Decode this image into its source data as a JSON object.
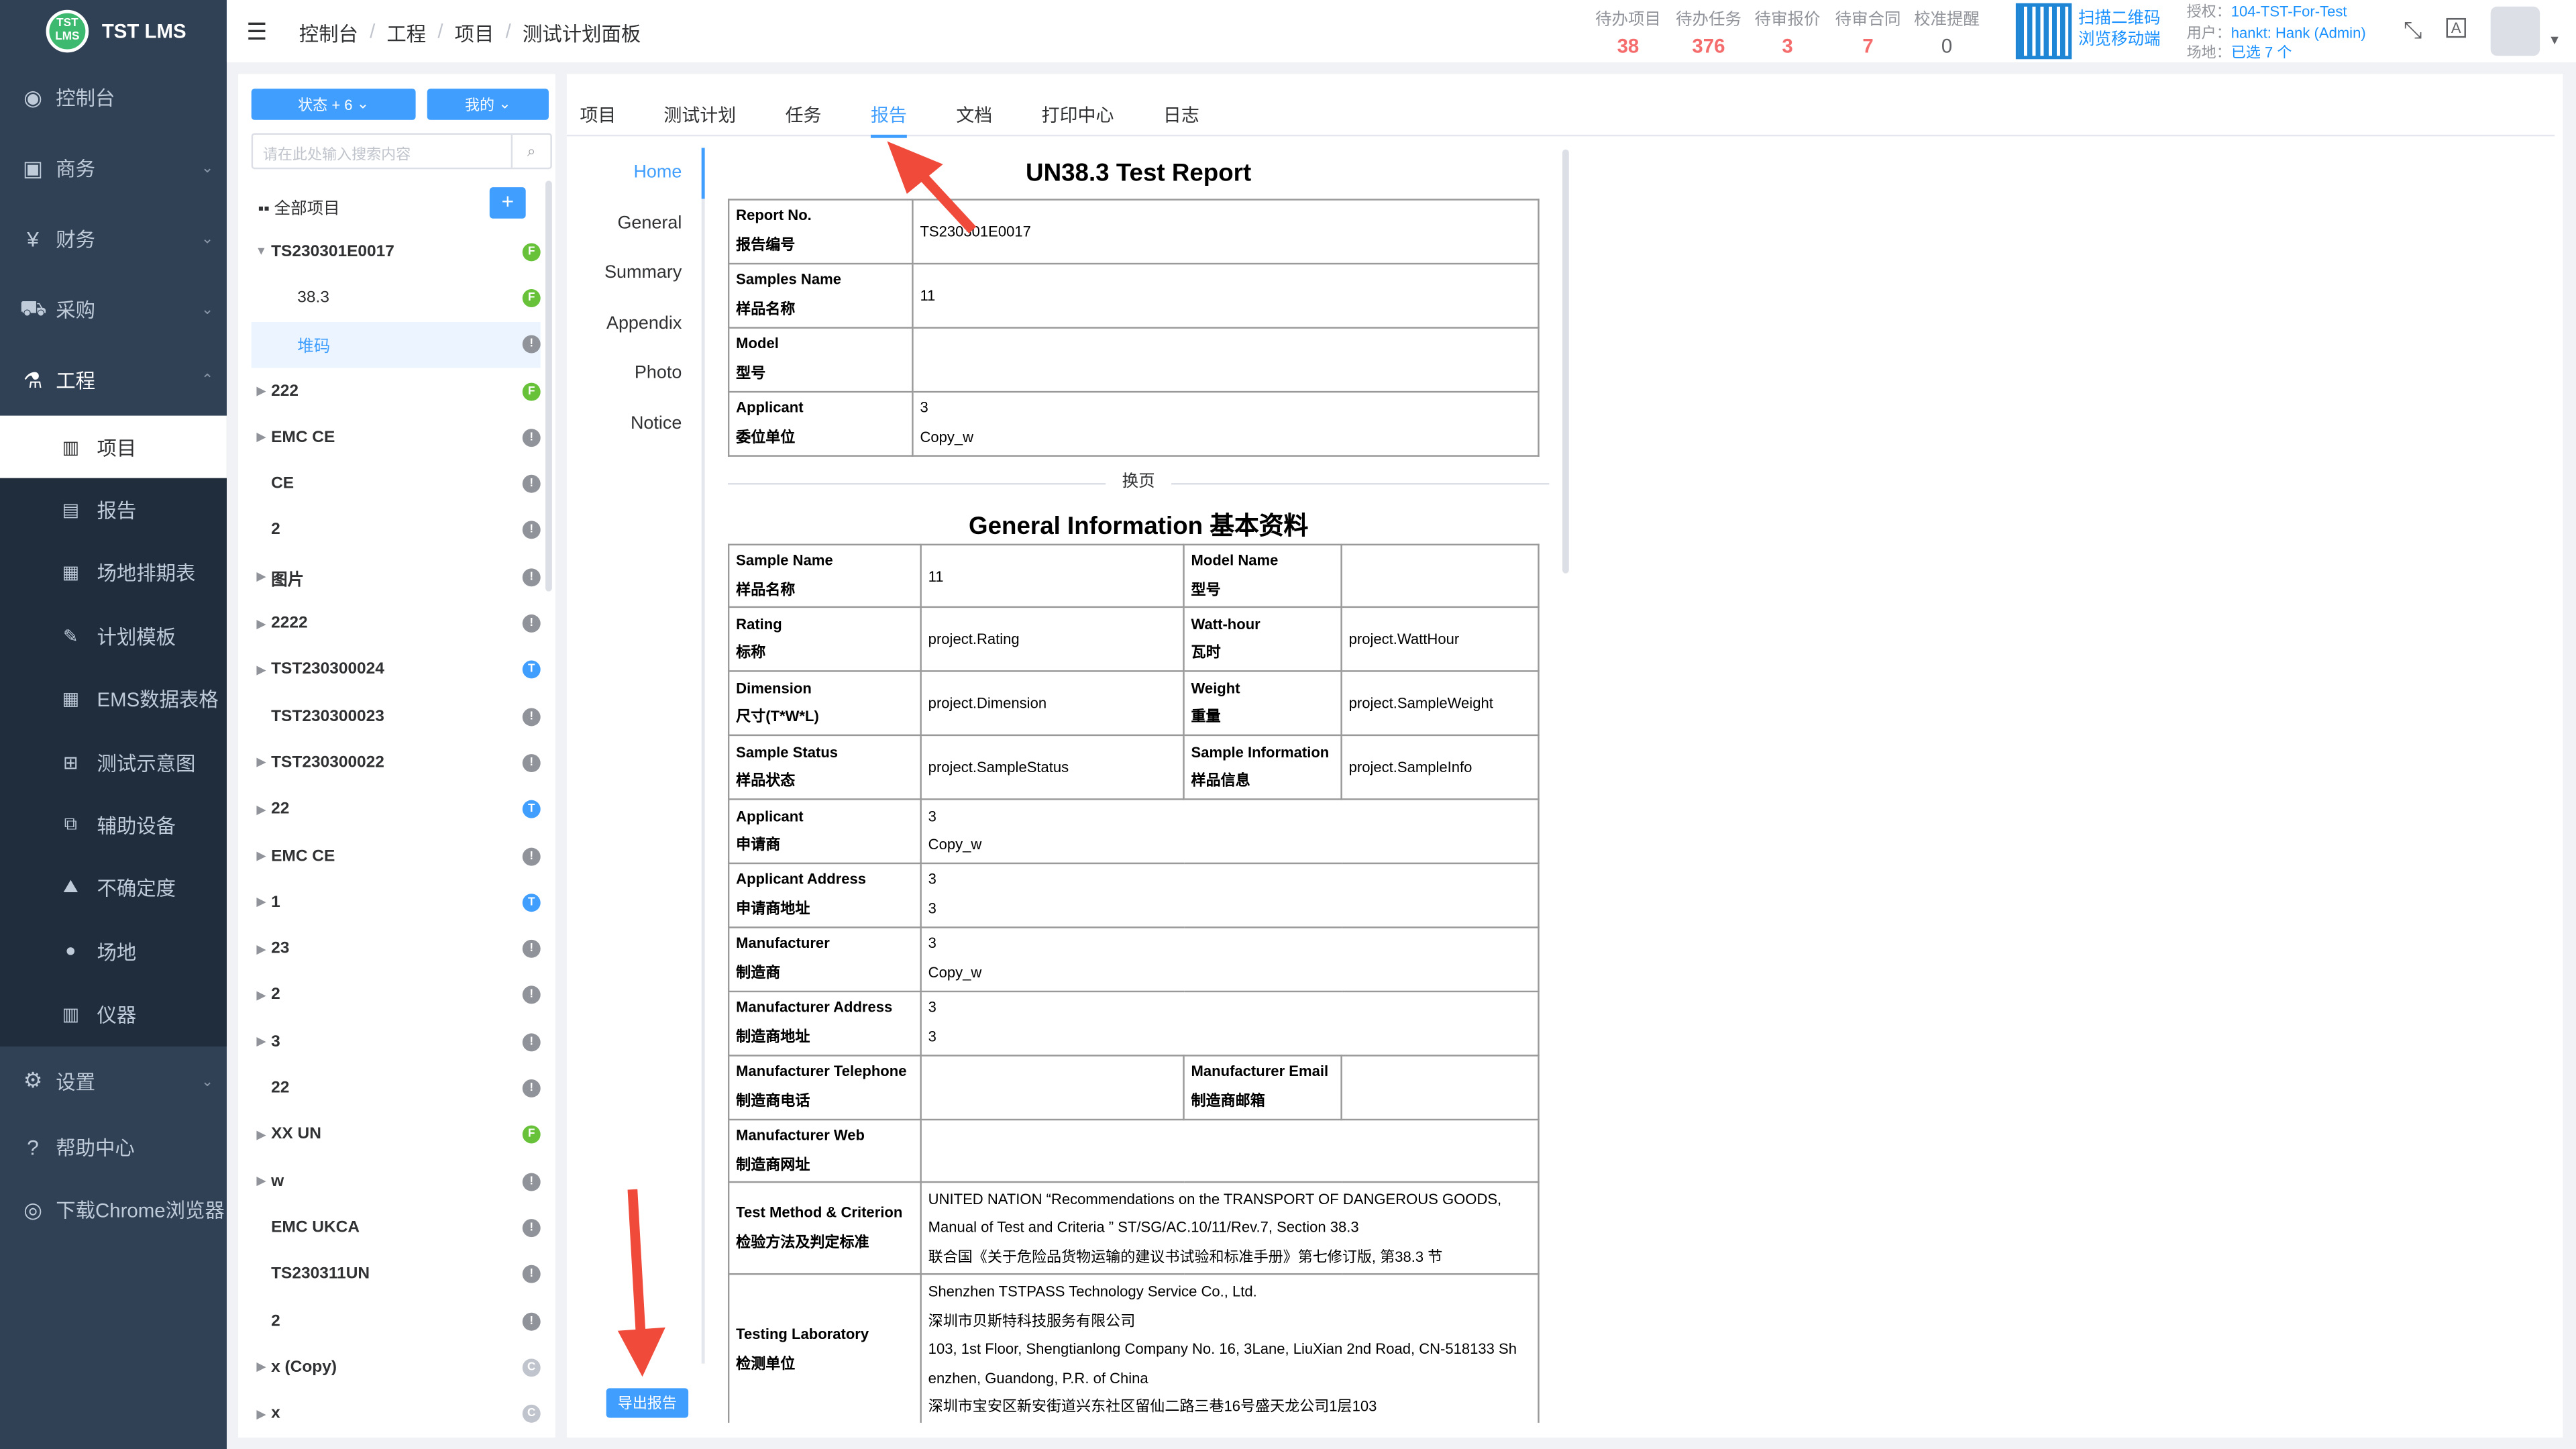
{
  "app": {
    "logo_line1": "TST",
    "logo_line2": "LMS",
    "name": "TST LMS"
  },
  "sidebar": {
    "items": [
      {
        "label": "控制台",
        "icon": "dashboard-icon"
      },
      {
        "label": "商务",
        "icon": "shopping-bag-icon"
      },
      {
        "label": "财务",
        "icon": "yen-icon"
      },
      {
        "label": "采购",
        "icon": "cart-icon"
      },
      {
        "label": "工程",
        "icon": "flask-icon"
      }
    ],
    "sub_items": [
      {
        "label": "项目",
        "icon": "project-icon"
      },
      {
        "label": "报告",
        "icon": "report-icon"
      },
      {
        "label": "场地排期表",
        "icon": "schedule-icon"
      },
      {
        "label": "计划模板",
        "icon": "template-icon"
      },
      {
        "label": "EMS数据表格",
        "icon": "grid-icon"
      },
      {
        "label": "测试示意图",
        "icon": "diagram-icon"
      },
      {
        "label": "辅助设备",
        "icon": "device-icon"
      },
      {
        "label": "不确定度",
        "icon": "chart-icon"
      },
      {
        "label": "场地",
        "icon": "user-icon"
      },
      {
        "label": "仪器",
        "icon": "instrument-icon"
      }
    ],
    "bottom_items": [
      {
        "label": "设置",
        "icon": "gear-icon"
      },
      {
        "label": "帮助中心",
        "icon": "help-icon"
      },
      {
        "label": "下载Chrome浏览器",
        "icon": "chrome-icon"
      }
    ]
  },
  "header": {
    "breadcrumb": [
      "控制台",
      "工程",
      "项目",
      "测试计划面板"
    ],
    "stats": [
      {
        "label": "待办项目",
        "value": "38"
      },
      {
        "label": "待办任务",
        "value": "376"
      },
      {
        "label": "待审报价",
        "value": "3"
      },
      {
        "label": "待审合同",
        "value": "7"
      },
      {
        "label": "校准提醒",
        "value": "0"
      }
    ],
    "qr_line1": "扫描二维码",
    "qr_line2": "浏览移动端",
    "license_label": "授权：",
    "license_value": "104-TST-For-Test",
    "user_label": "用户：",
    "user_value": "hankt: Hank (Admin)",
    "site_label": "场地：",
    "site_value": "已选 7 个"
  },
  "filter": {
    "status_btn": "状态 + 6",
    "mine_btn": "我的",
    "search_placeholder": "请在此处输入搜索内容",
    "all_projects": "全部项目",
    "add": "+"
  },
  "tree": [
    {
      "label": "TS230301E0017",
      "status": "F",
      "color": "#67c23a",
      "arrow": "▼",
      "child": false
    },
    {
      "label": "38.3",
      "status": "F",
      "color": "#67c23a",
      "arrow": "",
      "child": true
    },
    {
      "label": "堆码",
      "status": "!",
      "color": "#909399",
      "arrow": "",
      "child": true,
      "sel": true
    },
    {
      "label": "222",
      "status": "F",
      "color": "#67c23a",
      "arrow": "▶",
      "child": false
    },
    {
      "label": "EMC CE",
      "status": "!",
      "color": "#909399",
      "arrow": "▶",
      "child": false
    },
    {
      "label": "CE",
      "status": "!",
      "color": "#909399",
      "arrow": "",
      "child": false
    },
    {
      "label": "2",
      "status": "!",
      "color": "#909399",
      "arrow": "",
      "child": false
    },
    {
      "label": "图片",
      "status": "!",
      "color": "#909399",
      "arrow": "▶",
      "child": false
    },
    {
      "label": "2222",
      "status": "!",
      "color": "#909399",
      "arrow": "▶",
      "child": false
    },
    {
      "label": "TST230300024",
      "status": "T",
      "color": "#409eff",
      "arrow": "▶",
      "child": false
    },
    {
      "label": "TST230300023",
      "status": "!",
      "color": "#909399",
      "arrow": "",
      "child": false
    },
    {
      "label": "TST230300022",
      "status": "!",
      "color": "#909399",
      "arrow": "▶",
      "child": false
    },
    {
      "label": "22",
      "status": "T",
      "color": "#409eff",
      "arrow": "▶",
      "child": false
    },
    {
      "label": "EMC CE",
      "status": "!",
      "color": "#909399",
      "arrow": "▶",
      "child": false
    },
    {
      "label": "1",
      "status": "T",
      "color": "#409eff",
      "arrow": "▶",
      "child": false
    },
    {
      "label": "23",
      "status": "!",
      "color": "#909399",
      "arrow": "▶",
      "child": false
    },
    {
      "label": "2",
      "status": "!",
      "color": "#909399",
      "arrow": "▶",
      "child": false
    },
    {
      "label": "3",
      "status": "!",
      "color": "#909399",
      "arrow": "▶",
      "child": false
    },
    {
      "label": "22",
      "status": "!",
      "color": "#909399",
      "arrow": "",
      "child": false
    },
    {
      "label": "XX UN",
      "status": "F",
      "color": "#67c23a",
      "arrow": "▶",
      "child": false
    },
    {
      "label": "w",
      "status": "!",
      "color": "#909399",
      "arrow": "▶",
      "child": false
    },
    {
      "label": "EMC UKCA",
      "status": "!",
      "color": "#909399",
      "arrow": "",
      "child": false
    },
    {
      "label": "TS230311UN",
      "status": "!",
      "color": "#909399",
      "arrow": "",
      "child": false
    },
    {
      "label": "2",
      "status": "!",
      "color": "#909399",
      "arrow": "",
      "child": false
    },
    {
      "label": "x (Copy)",
      "status": "C",
      "color": "#c0c4cc",
      "arrow": "▶",
      "child": false
    },
    {
      "label": "x",
      "status": "C",
      "color": "#c0c4cc",
      "arrow": "▶",
      "child": false
    }
  ],
  "tabs": [
    "项目",
    "测试计划",
    "任务",
    "报告",
    "文档",
    "打印中心",
    "日志"
  ],
  "active_tab": "报告",
  "report_nav": [
    "Home",
    "General",
    "Summary",
    "Appendix",
    "Photo",
    "Notice"
  ],
  "export_btn": "导出报告",
  "report": {
    "title": "UN38.3 Test Report",
    "cover": [
      {
        "k1": "Report No.",
        "k2": "报告编号",
        "v1": "TS230301E0017",
        "v2": ""
      },
      {
        "k1": "Samples Name",
        "k2": "样品名称",
        "v1": "11",
        "v2": ""
      },
      {
        "k1": "Model",
        "k2": "型号",
        "v1": "",
        "v2": ""
      },
      {
        "k1": "Applicant",
        "k2": "委位单位",
        "v1": "3",
        "v2": "Copy_w"
      }
    ],
    "page_break": "换页",
    "general_title": "General Information 基本资料",
    "general_pairs": [
      {
        "k1": "Sample Name",
        "k2": "样品名称",
        "v": "11",
        "k3": "Model Name",
        "k4": "型号",
        "v2": ""
      },
      {
        "k1": "Rating",
        "k2": "标称",
        "v": "project.Rating",
        "k3": "Watt-hour",
        "k4": "瓦时",
        "v2": "project.WattHour"
      },
      {
        "k1": "Dimension",
        "k2": "尺寸(T*W*L)",
        "v": "project.Dimension",
        "k3": "Weight",
        "k4": "重量",
        "v2": "project.SampleWeight"
      },
      {
        "k1": "Sample Status",
        "k2": "样品状态",
        "v": "project.SampleStatus",
        "k3": "Sample Information",
        "k4": "样品信息",
        "v2": "project.SampleInfo"
      }
    ],
    "general_single": [
      {
        "k1": "Applicant",
        "k2": "申请商",
        "v1": "3",
        "v2": "Copy_w"
      },
      {
        "k1": "Applicant Address",
        "k2": "申请商地址",
        "v1": "3",
        "v2": "3"
      },
      {
        "k1": "Manufacturer",
        "k2": "制造商",
        "v1": "3",
        "v2": "Copy_w"
      },
      {
        "k1": "Manufacturer Address",
        "k2": "制造商地址",
        "v1": "3",
        "v2": "3"
      }
    ],
    "mfg_tel": {
      "k1": "Manufacturer Telephone",
      "k2": "制造商电话",
      "k3": "Manufacturer Email",
      "k4": "制造商邮箱"
    },
    "mfg_web": {
      "k1": "Manufacturer Web",
      "k2": "制造商网址"
    },
    "test_method": {
      "k1": "Test Method & Criterion",
      "k2": "检验方法及判定标准",
      "l1": "UNITED NATION “Recommendations on the TRANSPORT OF DANGEROUS GOODS,",
      "l2": "Manual of Test and Criteria ” ST/SG/AC.10/11/Rev.7, Section 38.3",
      "l3": "联合国《关于危险品货物运输的建议书试验和标准手册》第七修订版, 第38.3 节"
    },
    "lab": {
      "k1": "Testing Laboratory",
      "k2": "检测单位",
      "l1": "Shenzhen TSTPASS Technology Service Co., Ltd.",
      "l2": "深圳市贝斯特科技服务有限公司",
      "l3": "103, 1st Floor, Shengtianlong Company No. 16, 3Lane, LiuXian 2nd Road, CN-518133 Sh",
      "l4": "enzhen, Guandong, P.R. of China",
      "l5": "深圳市宝安区新安街道兴东社区留仙二路三巷16号盛天龙公司1层103"
    }
  }
}
